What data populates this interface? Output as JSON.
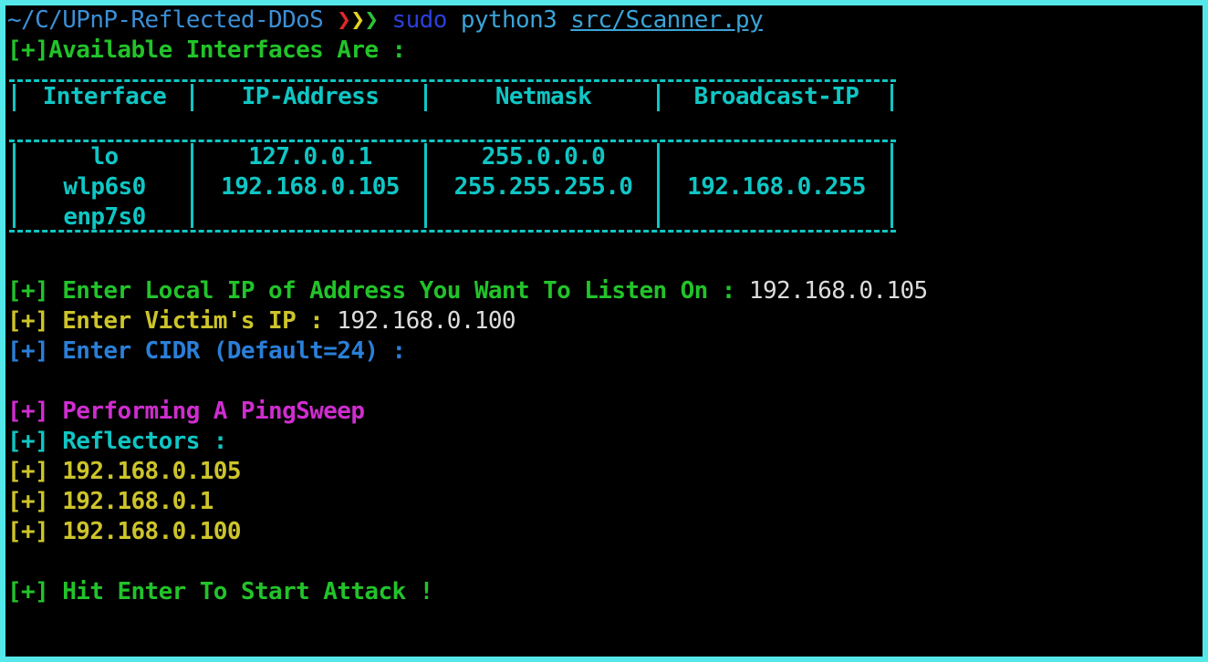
{
  "prompt": {
    "path": "~/C/UPnP-Reflected-DDoS",
    "chevrons": [
      "❯",
      "❯",
      "❯"
    ],
    "sudo": "sudo",
    "command": "python3",
    "argument": "src/Scanner.py"
  },
  "interfaces_heading": "[+]Available Interfaces Are :",
  "table": {
    "headers": [
      "Interface",
      "IP-Address",
      "Netmask",
      "Broadcast-IP"
    ],
    "rows": [
      [
        "lo",
        "127.0.0.1",
        "255.0.0.0",
        ""
      ],
      [
        "wlp6s0",
        "192.168.0.105",
        "255.255.255.0",
        "192.168.0.255"
      ],
      [
        "enp7s0",
        "",
        "",
        ""
      ]
    ]
  },
  "prompts": {
    "local_ip_marker": "[+]",
    "local_ip_label": " Enter Local IP of Address You Want To Listen On : ",
    "local_ip_value": "192.168.0.105",
    "victim_marker": "[+]",
    "victim_label": " Enter Victim's IP : ",
    "victim_value": "192.168.0.100",
    "cidr_marker": "[+]",
    "cidr_label": " Enter CIDR (Default=24) :"
  },
  "sweep": {
    "marker": "[+]",
    "label": " Performing A PingSweep"
  },
  "reflectors": {
    "marker": "[+]",
    "label": " Reflectors :",
    "items": [
      {
        "marker": "[+]",
        "ip": " 192.168.0.105"
      },
      {
        "marker": "[+]",
        "ip": " 192.168.0.1"
      },
      {
        "marker": "[+]",
        "ip": " 192.168.0.100"
      }
    ]
  },
  "final": {
    "marker": "[+]",
    "label": " Hit Enter To Start Attack !"
  },
  "colors": {
    "frame": "#55e8ea",
    "background": "#000000",
    "green": "#22c32a",
    "cyan": "#0fc6c4",
    "yellow": "#cdc42a",
    "blue": "#2a7fd8",
    "magenta": "#cf2dcf"
  }
}
